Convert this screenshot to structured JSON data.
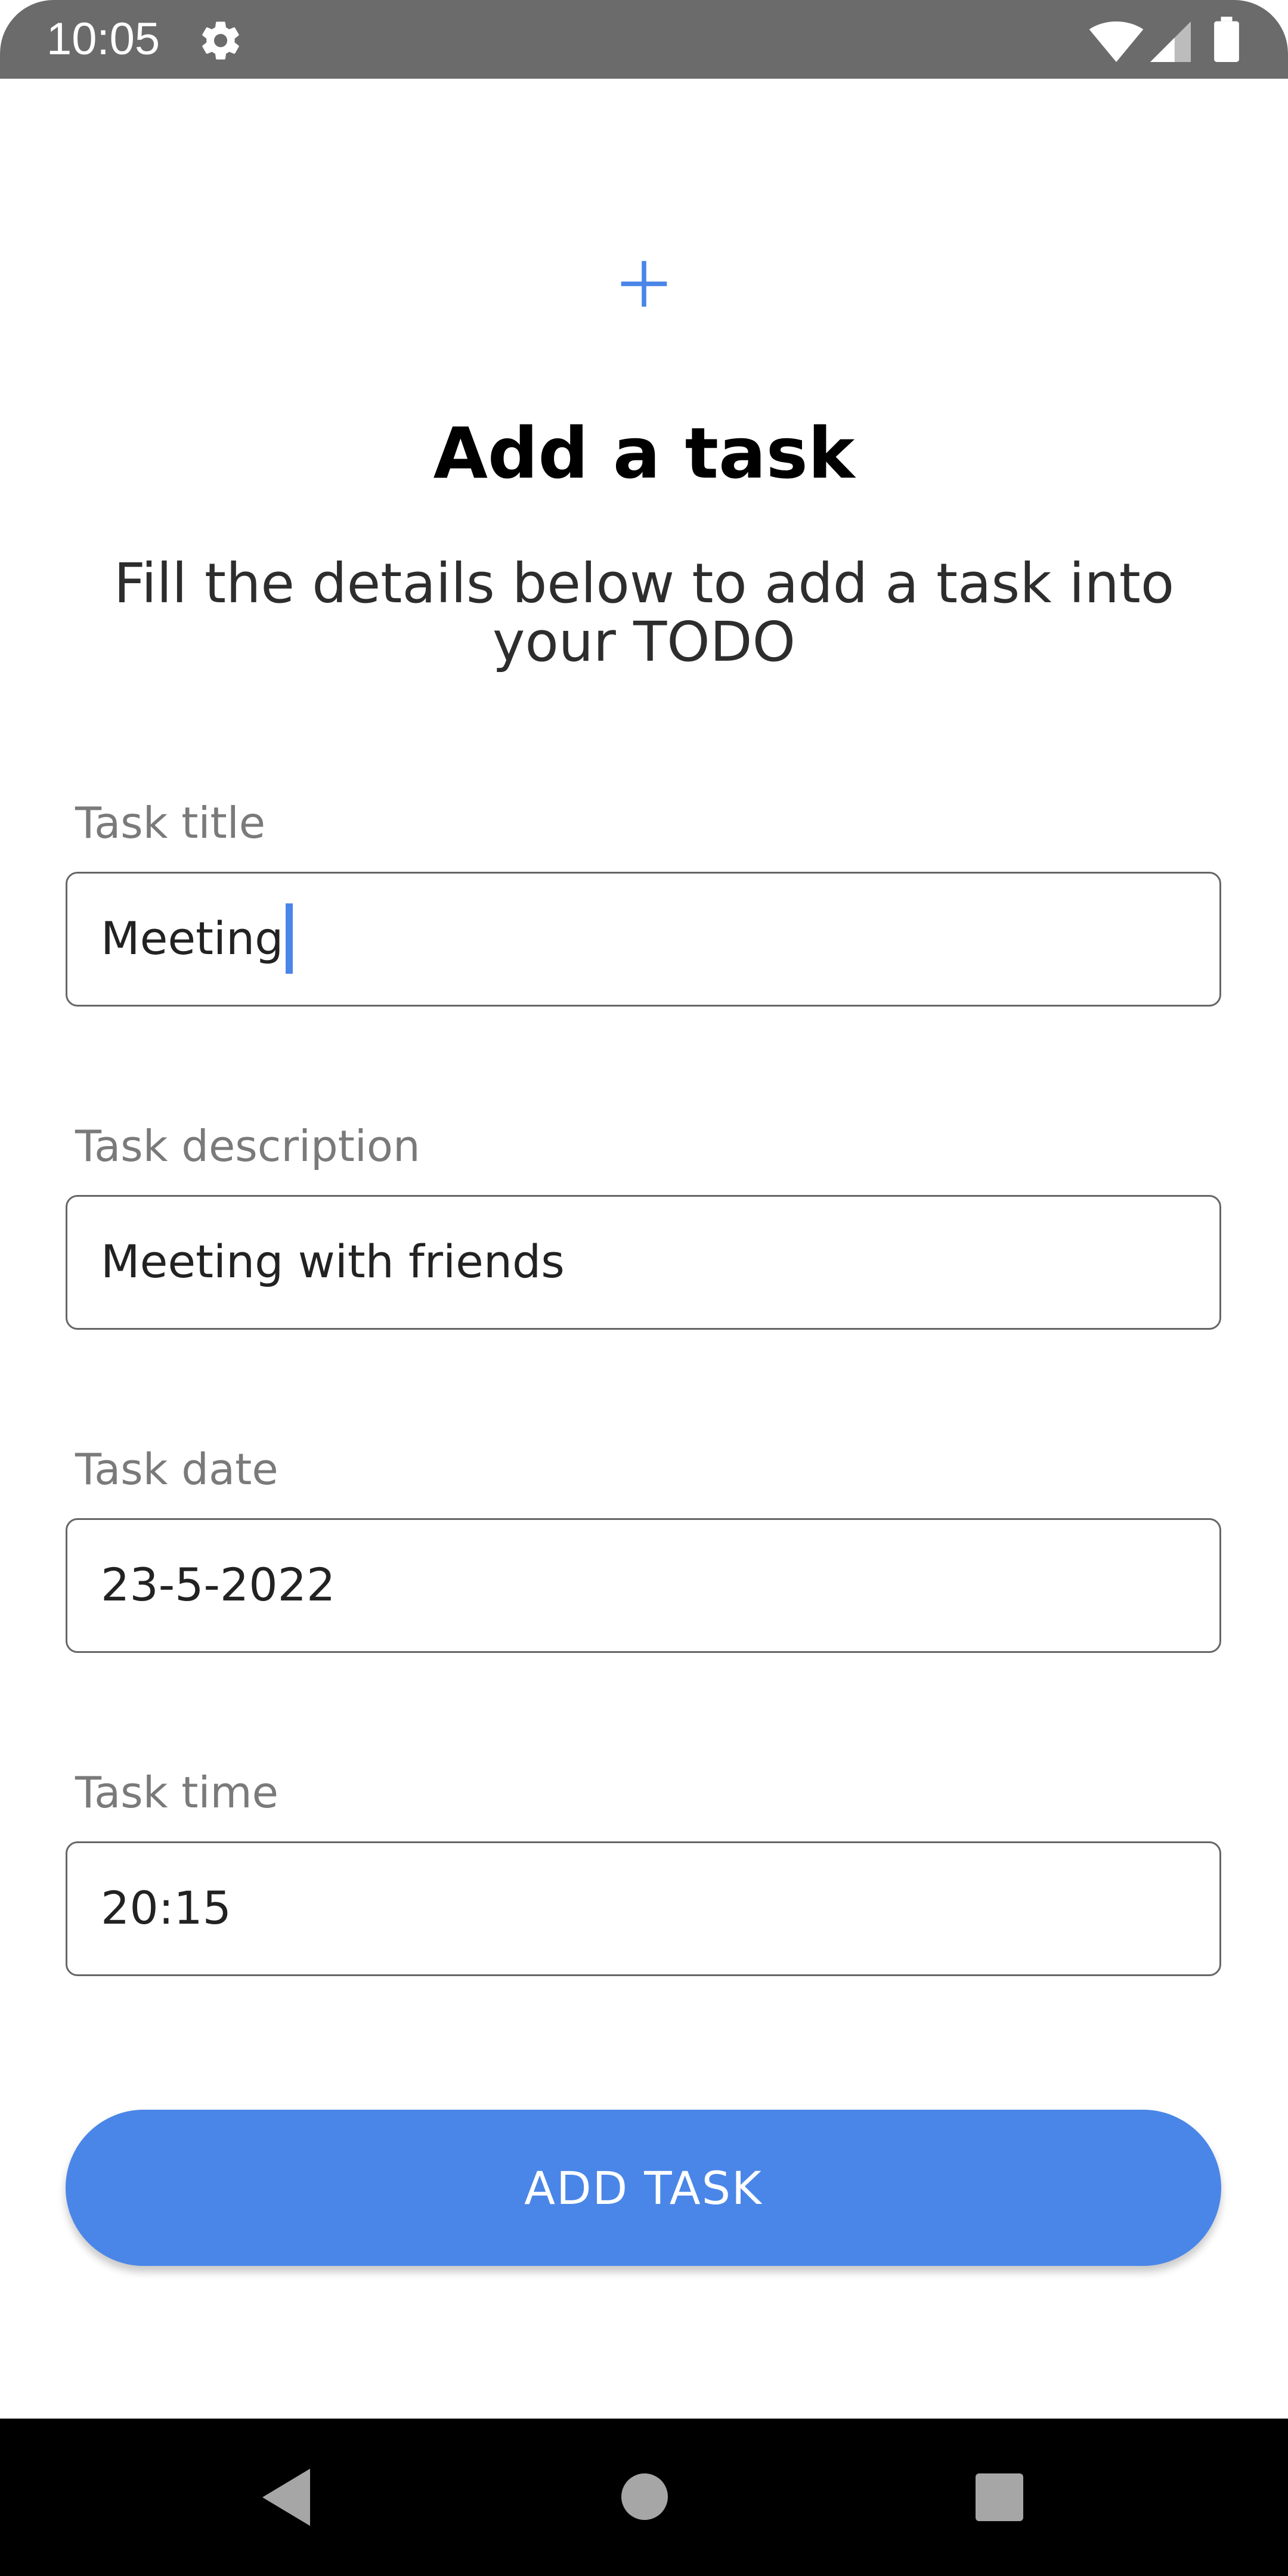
{
  "status_bar": {
    "time": "10:05",
    "icons": [
      "gear-icon",
      "wifi-icon",
      "cell-signal-icon",
      "battery-icon"
    ]
  },
  "header": {
    "icon": "plus-icon",
    "title": "Add a task",
    "subtitle": "Fill the details below to add a task into your TODO"
  },
  "form": {
    "task_title": {
      "label": "Task title",
      "value": "Meeting"
    },
    "task_description": {
      "label": "Task description",
      "value": "Meeting with friends"
    },
    "task_date": {
      "label": "Task date",
      "value": "23-5-2022"
    },
    "task_time": {
      "label": "Task time",
      "value": "20:15"
    }
  },
  "actions": {
    "add_task_label": "ADD TASK"
  },
  "nav_bar": {
    "icons": [
      "back-icon",
      "home-icon",
      "recents-icon"
    ]
  },
  "colors": {
    "accent": "#4a86e8",
    "status_bar": "#6b6b6b",
    "nav_bar": "#000000",
    "label": "#7a7a7a"
  }
}
